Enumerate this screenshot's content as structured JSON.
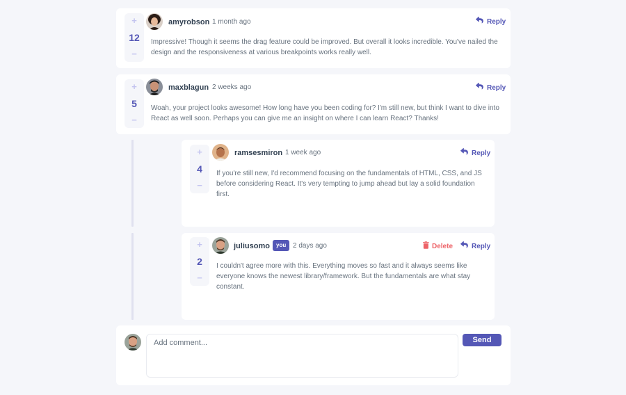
{
  "comments": [
    {
      "score": "12",
      "username": "amyrobson",
      "time": "1 month ago",
      "reply_label": "Reply",
      "text": "Impressive! Though it seems the drag feature could be improved. But overall it looks incredible. You've nailed the design and the responsiveness at various breakpoints works really well."
    },
    {
      "score": "5",
      "username": "maxblagun",
      "time": "2 weeks ago",
      "reply_label": "Reply",
      "text": "Woah, your project looks awesome! How long have you been coding for? I'm still new, but think I want to dive into React as well soon. Perhaps you can give me an insight on where I can learn React? Thanks!"
    }
  ],
  "replies": [
    {
      "score": "4",
      "username": "ramsesmiron",
      "time": "1 week ago",
      "reply_label": "Reply",
      "text": "If you're still new, I'd recommend focusing on the fundamentals of HTML, CSS, and JS before considering React. It's very tempting to jump ahead but lay a solid foundation first."
    },
    {
      "score": "2",
      "username": "juliusomo",
      "you_badge": "you",
      "time": "2 days ago",
      "delete_label": "Delete",
      "reply_label": "Reply",
      "text": "I couldn't agree more with this. Everything moves so fast and it always seems like everyone knows the newest library/framework. But the fundamentals are what stay constant."
    }
  ],
  "composer": {
    "placeholder": "Add comment...",
    "send_label": "Send"
  },
  "vote": {
    "plus": "+",
    "minus": "−"
  },
  "colors": {
    "background": "#f5f6fa",
    "accent": "#5457b6",
    "accent_light": "#c3c4ef",
    "danger": "#ed6368",
    "heading": "#334253",
    "text": "#67727e"
  }
}
